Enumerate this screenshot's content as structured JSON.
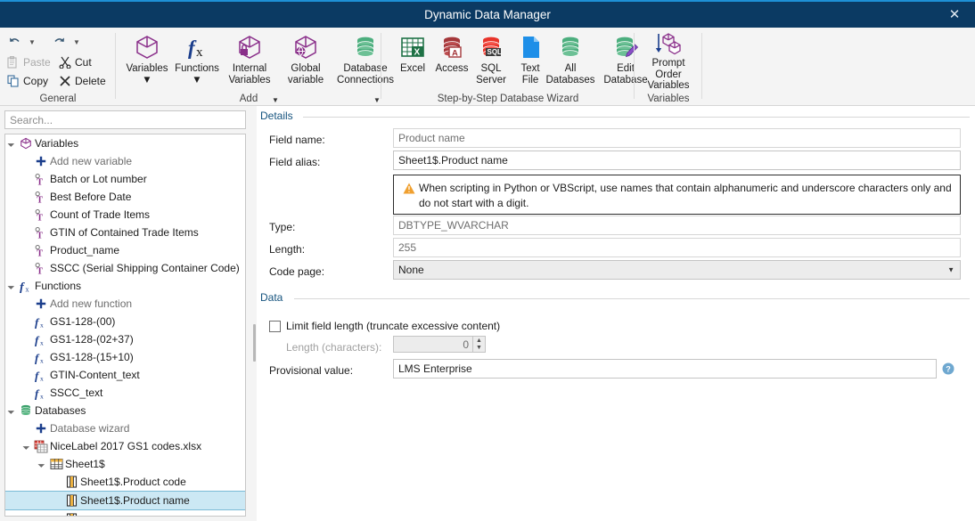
{
  "window": {
    "title": "Dynamic Data Manager",
    "close_label": "✕"
  },
  "ribbon": {
    "groups": [
      {
        "name": "General",
        "label": "General"
      },
      {
        "name": "Add",
        "label": "Add"
      },
      {
        "name": "Wizard",
        "label": "Step-by-Step Database Wizard"
      },
      {
        "name": "PromptVars",
        "label": "Variables"
      }
    ],
    "general": {
      "undo": "",
      "redo": "",
      "paste": "Paste",
      "cut": "Cut",
      "copy": "Copy",
      "delete": "Delete"
    },
    "add_buttons": [
      {
        "label": "Variables",
        "caret": true
      },
      {
        "label": "Functions",
        "caret": true
      },
      {
        "label": "Internal\nVariables",
        "caret": true
      },
      {
        "label": "Global\nvariable",
        "caret": false
      },
      {
        "label": "Database\nConnections",
        "caret": true
      }
    ],
    "wizard_buttons": [
      {
        "label": "Excel"
      },
      {
        "label": "Access"
      },
      {
        "label": "SQL\nServer"
      },
      {
        "label": "Text\nFile"
      },
      {
        "label": "All\nDatabases"
      },
      {
        "label": "Edit\nDatabase"
      }
    ],
    "prompt_buttons": [
      {
        "label": "Prompt\nOrder\nVariables"
      }
    ]
  },
  "sidebar": {
    "search": {
      "value": "",
      "placeholder": "Search..."
    },
    "tree": [
      {
        "depth": 0,
        "expander": "◢",
        "icon": "cube-icon",
        "label": "Variables",
        "muted": false,
        "selected": false
      },
      {
        "depth": 1,
        "expander": "",
        "icon": "plus-icon",
        "label": "Add new variable",
        "muted": true,
        "selected": false
      },
      {
        "depth": 1,
        "expander": "",
        "icon": "variable-icon",
        "label": "Batch or Lot number",
        "muted": false,
        "selected": false
      },
      {
        "depth": 1,
        "expander": "",
        "icon": "variable-icon",
        "label": "Best Before Date",
        "muted": false,
        "selected": false
      },
      {
        "depth": 1,
        "expander": "",
        "icon": "variable-icon",
        "label": "Count of Trade Items",
        "muted": false,
        "selected": false
      },
      {
        "depth": 1,
        "expander": "",
        "icon": "variable-icon",
        "label": "GTIN of Contained Trade Items",
        "muted": false,
        "selected": false
      },
      {
        "depth": 1,
        "expander": "",
        "icon": "variable-icon",
        "label": "Product_name",
        "muted": false,
        "selected": false
      },
      {
        "depth": 1,
        "expander": "",
        "icon": "variable-icon",
        "label": "SSCC (Serial Shipping Container Code)",
        "muted": false,
        "selected": false
      },
      {
        "depth": 0,
        "expander": "◢",
        "icon": "fx-icon",
        "label": "Functions",
        "muted": false,
        "selected": false
      },
      {
        "depth": 1,
        "expander": "",
        "icon": "plus-icon",
        "label": "Add new function",
        "muted": true,
        "selected": false
      },
      {
        "depth": 1,
        "expander": "",
        "icon": "fx-small-icon",
        "label": "GS1-128-(00)",
        "muted": false,
        "selected": false
      },
      {
        "depth": 1,
        "expander": "",
        "icon": "fx-small-icon",
        "label": "GS1-128-(02+37)",
        "muted": false,
        "selected": false
      },
      {
        "depth": 1,
        "expander": "",
        "icon": "fx-small-icon",
        "label": "GS1-128-(15+10)",
        "muted": false,
        "selected": false
      },
      {
        "depth": 1,
        "expander": "",
        "icon": "fx-small-icon",
        "label": "GTIN-Content_text",
        "muted": false,
        "selected": false
      },
      {
        "depth": 1,
        "expander": "",
        "icon": "fx-small-icon",
        "label": "SSCC_text",
        "muted": false,
        "selected": false
      },
      {
        "depth": 0,
        "expander": "◢",
        "icon": "database-icon",
        "label": "Databases",
        "muted": false,
        "selected": false
      },
      {
        "depth": 1,
        "expander": "",
        "icon": "plus-icon",
        "label": "Database wizard",
        "muted": true,
        "selected": false
      },
      {
        "depth": 1,
        "expander": "◢",
        "icon": "workbook-icon",
        "label": "NiceLabel 2017 GS1 codes.xlsx",
        "muted": false,
        "selected": false
      },
      {
        "depth": 2,
        "expander": "◢",
        "icon": "table-icon",
        "label": "Sheet1$",
        "muted": false,
        "selected": false
      },
      {
        "depth": 3,
        "expander": "",
        "icon": "field-icon",
        "label": "Sheet1$.Product code",
        "muted": false,
        "selected": false
      },
      {
        "depth": 3,
        "expander": "",
        "icon": "field-icon",
        "label": "Sheet1$.Product name",
        "muted": false,
        "selected": true
      },
      {
        "depth": 3,
        "expander": "",
        "icon": "field-icon",
        "label": "",
        "muted": false,
        "selected": false
      }
    ]
  },
  "details": {
    "group_label": "Details",
    "field_name_label": "Field name:",
    "field_name_value": "Product name",
    "field_alias_label": "Field alias:",
    "field_alias_value": "Sheet1$.Product name",
    "warning_text": "When scripting in Python or VBScript, use names that contain alphanumeric and underscore characters only and do not start with a digit.",
    "type_label": "Type:",
    "type_value": "DBTYPE_WVARCHAR",
    "length_label": "Length:",
    "length_value": "255",
    "code_page_label": "Code page:",
    "code_page_value": "None"
  },
  "data_section": {
    "group_label": "Data",
    "limit_checkbox_label": "Limit field length (truncate excessive content)",
    "limit_checked": false,
    "length_chars_label": "Length (characters):",
    "length_chars_value": "0",
    "provisional_label": "Provisional value:",
    "provisional_value": "LMS Enterprise"
  },
  "colors": {
    "title_bar": "#0b3a63",
    "accent_top": "#1e90d6",
    "purple": "#8a2f8a",
    "green": "#2e9e63",
    "blue": "#1f6fc4",
    "selection": "#cce8f4",
    "group_title": "#15537e",
    "warning": "#f0a030"
  }
}
